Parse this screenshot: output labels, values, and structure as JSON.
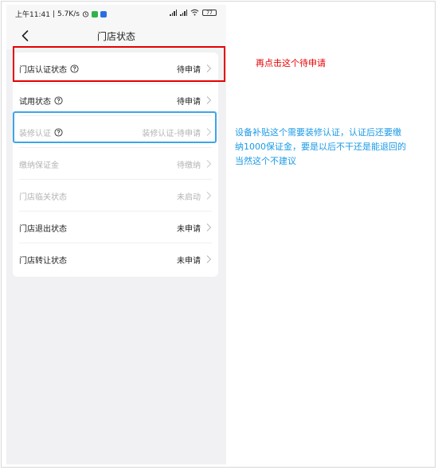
{
  "status_bar": {
    "time": "上午11:41",
    "separator": "|",
    "speed": "5.7K/s",
    "battery": "77"
  },
  "nav": {
    "title": "门店状态"
  },
  "rows": [
    {
      "label": "门店认证状态",
      "value": "待申请",
      "help": true,
      "disabled": false
    },
    {
      "label": "试用状态",
      "value": "待申请",
      "help": true,
      "disabled": false
    },
    {
      "label": "装修认证",
      "value": "装修认证-待申请",
      "help": true,
      "disabled": true
    },
    {
      "label": "缴纳保证金",
      "value": "待缴纳",
      "help": false,
      "disabled": true
    },
    {
      "label": "门店临关状态",
      "value": "未启动",
      "help": false,
      "disabled": true
    },
    {
      "label": "门店退出状态",
      "value": "未申请",
      "help": false,
      "disabled": false
    },
    {
      "label": "门店转让状态",
      "value": "未申请",
      "help": false,
      "disabled": false
    }
  ],
  "annotations": {
    "red_note": "再点击这个待申请",
    "blue_note_lines": [
      "设备补贴这个需要装修认证，认证后还要缴",
      "纳1000保证金，要是以后不干还是能退回的",
      "当然这个不建议"
    ]
  },
  "colors": {
    "annotation_red": "#e60000",
    "annotation_blue": "#1a9ae6",
    "disabled_text": "#b3b3b3"
  }
}
